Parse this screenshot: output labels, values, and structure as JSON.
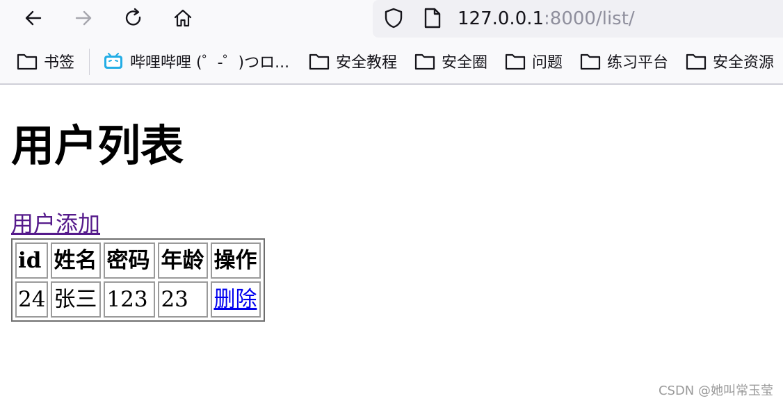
{
  "browser": {
    "url_host": "127.0.0.1",
    "url_rest": ":8000/list/",
    "bookmarks": [
      {
        "label": "书签",
        "icon": "folder-icon"
      },
      {
        "label": "哔哩哔哩 (゜-゜)つロ...",
        "icon": "bilibili-icon"
      },
      {
        "label": "安全教程",
        "icon": "folder-icon"
      },
      {
        "label": "安全圈",
        "icon": "folder-icon"
      },
      {
        "label": "问题",
        "icon": "folder-icon"
      },
      {
        "label": "练习平台",
        "icon": "folder-icon"
      },
      {
        "label": "安全资源",
        "icon": "folder-icon"
      }
    ]
  },
  "page": {
    "title": "用户列表",
    "add_link": "用户添加",
    "table": {
      "headers": [
        "id",
        "姓名",
        "密码",
        "年龄",
        "操作"
      ],
      "rows": [
        {
          "id": "24",
          "name": "张三",
          "password": "123",
          "age": "23",
          "action": "删除"
        }
      ]
    }
  },
  "watermark": "CSDN @她叫常玉莹",
  "colors": {
    "visited_link": "#551a8b",
    "link": "#0000ee",
    "chrome_background": "#f9f9fb",
    "urlbar_background": "#f0f0f4",
    "bilibili_accent": "#23ade5"
  }
}
